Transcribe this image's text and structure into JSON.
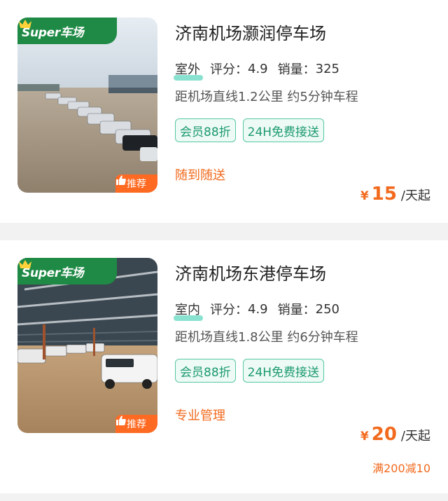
{
  "listings": [
    {
      "super_badge": "Super车场",
      "recommend_badge": "推荐",
      "name": "济南机场灏润停车场",
      "location_type": "室外",
      "rating_label": "评分：",
      "rating": "4.9",
      "sales_label": "销量：",
      "sales": "325",
      "distance": "距机场直线1.2公里 约5分钟车程",
      "tags": [
        "会员88折",
        "24H免费接送"
      ],
      "service": "随到随送",
      "currency": "¥",
      "price": "15",
      "price_unit": "/天起",
      "promo": ""
    },
    {
      "super_badge": "Super车场",
      "recommend_badge": "推荐",
      "name": "济南机场东港停车场",
      "location_type": "室内",
      "rating_label": "评分：",
      "rating": "4.9",
      "sales_label": "销量：",
      "sales": "250",
      "distance": "距机场直线1.8公里 约6分钟车程",
      "tags": [
        "会员88折",
        "24H免费接送"
      ],
      "service": "专业管理",
      "currency": "¥",
      "price": "20",
      "price_unit": "/天起",
      "promo": "满200减10"
    }
  ],
  "colors": {
    "brand_green": "#1f8a45",
    "accent_orange": "#f26a1d",
    "tag_green": "#1a9a6e",
    "separator": "#f2f2f2"
  },
  "icons": [
    "crown-icon",
    "thumbs-up-icon"
  ]
}
